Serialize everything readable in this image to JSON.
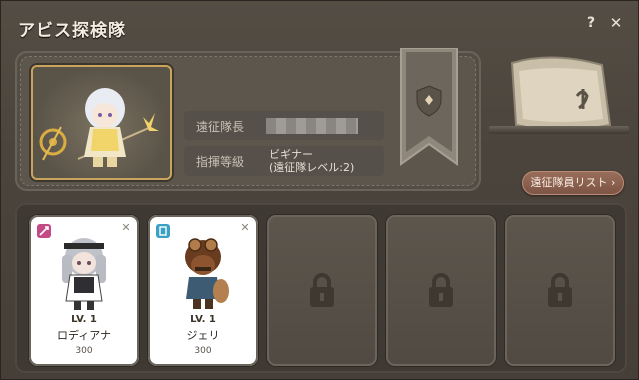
{
  "window": {
    "title": "アビス探検隊",
    "help_label": "?",
    "close_label": "✕"
  },
  "leader": {
    "leader_label": "遠征隊長",
    "rank_label": "指揮等級",
    "rank_value_line1": "ビギナー",
    "rank_value_line2": "(遠征隊レベル:2)"
  },
  "member_list_button": "遠征隊員リスト",
  "member_list_button_arrow": "›",
  "slots": [
    {
      "level": "LV. 1",
      "name": "ロディアナ",
      "points": "300",
      "type_icon": "sword-class-icon",
      "type_color": "#c44a86"
    },
    {
      "level": "LV. 1",
      "name": "ジェリ",
      "points": "300",
      "type_icon": "magic-class-icon",
      "type_color": "#3aa0c4"
    }
  ],
  "locked_slots": 3
}
